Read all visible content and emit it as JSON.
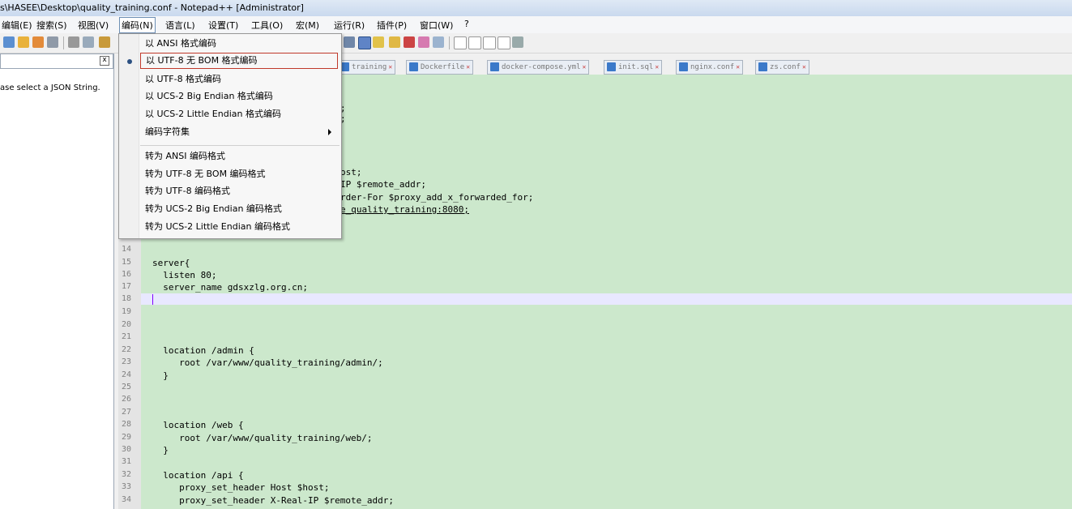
{
  "window": {
    "title": "s\\HASEE\\Desktop\\quality_training.conf - Notepad++ [Administrator]"
  },
  "menubar": [
    "编辑(E)",
    "搜索(S)",
    "视图(V)",
    "编码(N)",
    "语言(L)",
    "设置(T)",
    "工具(O)",
    "宏(M)",
    "运行(R)",
    "插件(P)",
    "窗口(W)",
    "?"
  ],
  "encoding_menu": {
    "items": [
      "以 ANSI 格式编码",
      "以 UTF-8 无 BOM 格式编码",
      "以 UTF-8 格式编码",
      "以 UCS-2 Big Endian 格式编码",
      "以 UCS-2 Little Endian 格式编码",
      "编码字符集",
      "转为 ANSI 编码格式",
      "转为 UTF-8 无 BOM 编码格式",
      "转为 UTF-8 编码格式",
      "转为 UCS-2 Big Endian 编码格式",
      "转为 UCS-2 Little Endian 编码格式"
    ],
    "selected": "以 UTF-8 无 BOM 格式编码"
  },
  "panel": {
    "close": "x",
    "message": "ase select a JSON String."
  },
  "tabs": [
    "training",
    "Dockerfile",
    "docker-compose.yml",
    "init.sql",
    "nginx.conf",
    "zs.conf"
  ],
  "partial_code": [
    ";",
    ";",
    "ost;",
    "IP $remote_addr;",
    "rder-For $proxy_add_x_forwarded_for;",
    "e_quality_training:8080;"
  ],
  "code": [
    {
      "n": "14",
      "t": ""
    },
    {
      "n": "15",
      "t": "server{"
    },
    {
      "n": "16",
      "t": "  listen 80;"
    },
    {
      "n": "17",
      "t": "  server_name gdsxzlg.org.cn;"
    },
    {
      "n": "18",
      "t": ""
    },
    {
      "n": "19",
      "t": ""
    },
    {
      "n": "20",
      "t": ""
    },
    {
      "n": "21",
      "t": ""
    },
    {
      "n": "22",
      "t": "  location /admin {"
    },
    {
      "n": "23",
      "t": "     root /var/www/quality_training/admin/;"
    },
    {
      "n": "24",
      "t": "  }"
    },
    {
      "n": "25",
      "t": ""
    },
    {
      "n": "26",
      "t": ""
    },
    {
      "n": "27",
      "t": ""
    },
    {
      "n": "28",
      "t": "  location /web {"
    },
    {
      "n": "29",
      "t": "     root /var/www/quality_training/web/;"
    },
    {
      "n": "30",
      "t": "  }"
    },
    {
      "n": "31",
      "t": ""
    },
    {
      "n": "32",
      "t": "  location /api {"
    },
    {
      "n": "33",
      "t": "     proxy_set_header Host $host;"
    },
    {
      "n": "34",
      "t": "     proxy_set_header X-Real-IP $remote_addr;"
    }
  ]
}
